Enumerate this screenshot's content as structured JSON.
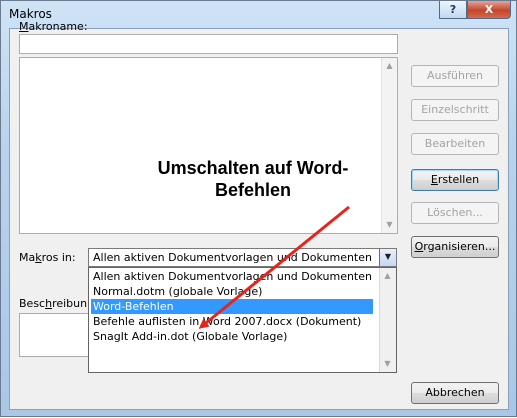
{
  "window": {
    "title": "Makros",
    "help_glyph": "?",
    "close_glyph": "X"
  },
  "labels": {
    "macro_name_prefix": "M",
    "macro_name_rest": "akroname:",
    "macros_in_prefix": "Ma",
    "macros_in_mid": "k",
    "macros_in_rest": "ros in:",
    "description_prefix": "Besc",
    "description_mid": "h",
    "description_rest": "reibun"
  },
  "inputs": {
    "macro_name_value": ""
  },
  "buttons": {
    "run": "Ausführen",
    "step": "Einzelschritt",
    "edit": "Bearbeiten",
    "create_prefix": "E",
    "create_rest": "rstellen",
    "delete": "Löschen...",
    "organize_prefix": "O",
    "organize_rest": "rganisieren...",
    "cancel": "Abbrechen"
  },
  "combo": {
    "selected": "Allen aktiven Dokumentvorlagen und Dokumenten",
    "options": [
      "Allen aktiven Dokumentvorlagen und Dokumenten",
      "Normal.dotm (globale Vorlage)",
      "Word-Befehlen",
      "Befehle auflisten in Word 2007.docx (Dokument)",
      "SnagIt Add-in.dot (Globale Vorlage)"
    ],
    "highlighted_index": 2
  },
  "annotation": {
    "line1": "Umschalten auf Word-",
    "line2": "Befehlen",
    "arrow_color": "#e8231c"
  },
  "icons": {
    "scroll_up": "▲",
    "scroll_down": "▼",
    "combo_arrow": "▼"
  }
}
